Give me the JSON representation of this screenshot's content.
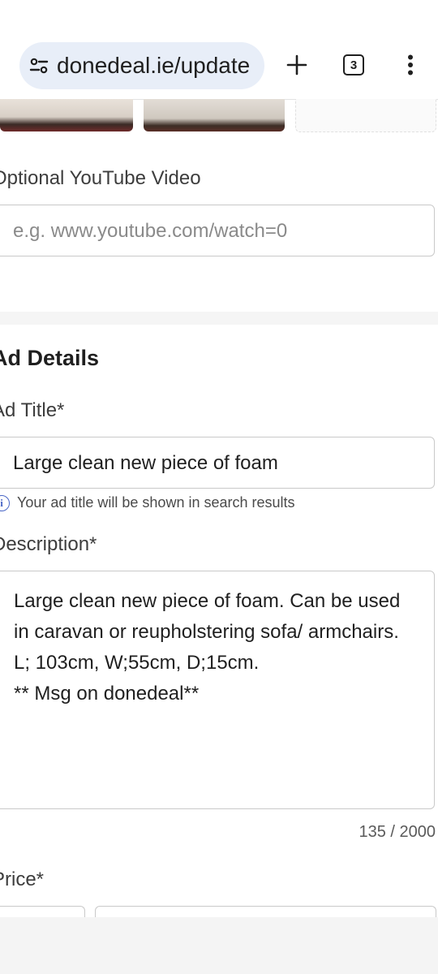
{
  "browser": {
    "url": "donedeal.ie/update",
    "tab_count": "3",
    "icons": [
      "site-settings-icon",
      "plus-icon",
      "tab-switcher-icon",
      "more-vert-icon"
    ]
  },
  "video": {
    "label": "Optional YouTube Video",
    "placeholder": "e.g. www.youtube.com/watch=0"
  },
  "ad_details": {
    "section_title": "Ad Details",
    "title_label": "Ad Title*",
    "title_value": "Large clean new piece of foam",
    "title_hint": "Your ad title will be shown in search results",
    "description_label": "Description*",
    "description_value": "Large clean new piece of foam. Can be used\nin caravan or reupholstering sofa/ armchairs.\nL; 103cm, W;55cm, D;15cm.\n** Msg on donedeal**",
    "description_count": "135 / 2000",
    "price_label": "Price*"
  },
  "colors": {
    "urlbar_bg": "#e8eef8",
    "info_accent": "#4a67c6"
  }
}
